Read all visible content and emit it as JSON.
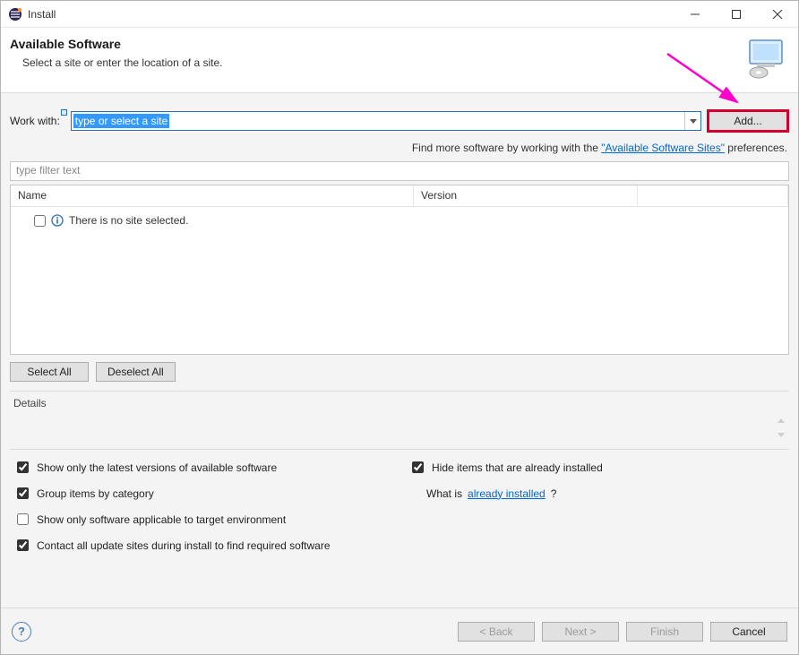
{
  "window": {
    "title": "Install"
  },
  "header": {
    "title": "Available Software",
    "subtitle": "Select a site or enter the location of a site."
  },
  "workwith": {
    "label": "Work with:",
    "placeholder": "type or select a site",
    "add_label": "Add..."
  },
  "hint": {
    "prefix": "Find more software by working with the ",
    "link": "\"Available Software Sites\"",
    "suffix": " preferences."
  },
  "filter": {
    "placeholder": "type filter text"
  },
  "table": {
    "columns": {
      "name": "Name",
      "version": "Version"
    },
    "empty_row": "There is no site selected."
  },
  "selection": {
    "select_all": "Select All",
    "deselect_all": "Deselect All"
  },
  "details": {
    "label": "Details"
  },
  "options": {
    "latest_only": {
      "label": "Show only the latest versions of available software",
      "checked": true
    },
    "hide_installed": {
      "label": "Hide items that are already installed",
      "checked": true
    },
    "group_category": {
      "label": "Group items by category",
      "checked": true
    },
    "what_is_prefix": "What is ",
    "what_is_link": "already installed",
    "what_is_suffix": "?",
    "target_env": {
      "label": "Show only software applicable to target environment",
      "checked": false
    },
    "contact_all": {
      "label": "Contact all update sites during install to find required software",
      "checked": true
    }
  },
  "footer": {
    "back": "< Back",
    "next": "Next >",
    "finish": "Finish",
    "cancel": "Cancel"
  }
}
